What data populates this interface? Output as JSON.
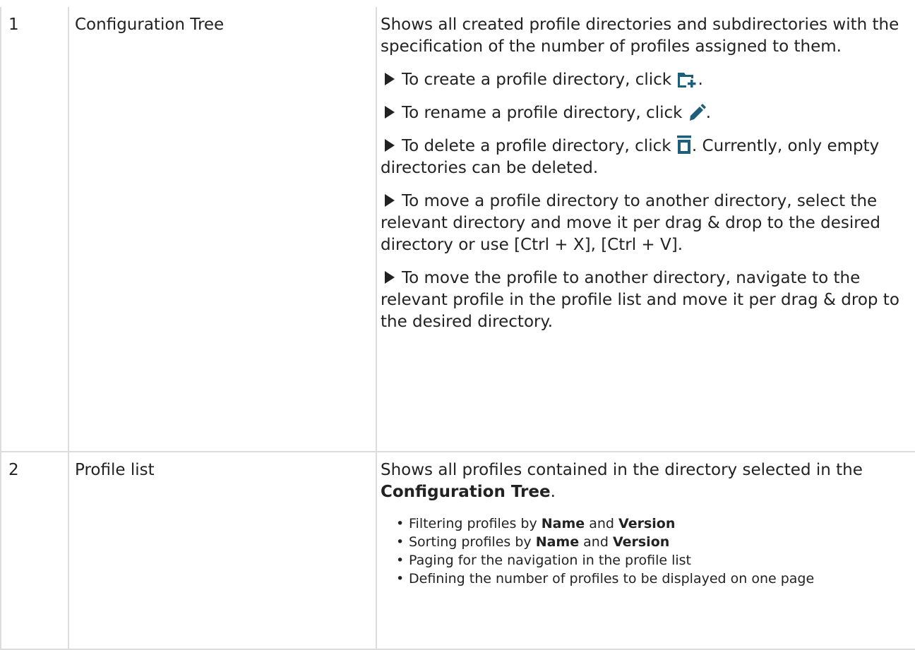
{
  "rows": [
    {
      "number": "1",
      "name": "Configuration Tree",
      "description": "Shows all created profile directories and subdirectories with the specification of the number of profiles assigned to them.",
      "steps": [
        {
          "pre": "To create a profile directory, click",
          "icon": "folder-plus-icon",
          "post": "."
        },
        {
          "pre": "To rename a profile directory, click",
          "icon": "pencil-icon",
          "post": "."
        },
        {
          "pre": "To delete a profile directory, click",
          "icon": "trash-icon",
          "post": ". Currently, only empty directories can be deleted."
        },
        {
          "pre": "To move a profile directory to another directory, select the relevant directory and move it per drag & drop to the desired directory or use [Ctrl + X], [Ctrl + V].",
          "icon": "",
          "post": ""
        },
        {
          "pre": "To move the profile to another directory, navigate to the relevant profile in the profile list and move it per drag & drop to the desired directory.",
          "icon": "",
          "post": ""
        }
      ]
    },
    {
      "number": "2",
      "name": "Profile list",
      "description_pre": "Shows all profiles contained in the directory selected in the",
      "description_bold": "Configuration Tree",
      "description_post": ".",
      "bullets": [
        {
          "pre": "Filtering profiles by",
          "b1": "Name",
          "mid": "and",
          "b2": "Version"
        },
        {
          "pre": "Sorting profiles by",
          "b1": "Name",
          "mid": "and",
          "b2": "Version"
        },
        {
          "pre": "Paging for the navigation in the profile list",
          "b1": "",
          "mid": "",
          "b2": ""
        },
        {
          "pre": "Defining the number of profiles to be displayed on one page",
          "b1": "",
          "mid": "",
          "b2": ""
        }
      ]
    }
  ],
  "colors": {
    "icon": "#1d5f7a",
    "border": "#dcdcdc",
    "text": "#222222"
  }
}
